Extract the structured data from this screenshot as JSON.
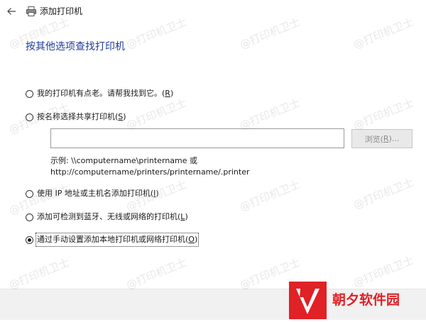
{
  "window": {
    "title": "添加打印机",
    "back_icon": "arrow-left-icon",
    "app_icon": "printer-icon"
  },
  "heading": "按其他选项查找打印机",
  "options": [
    {
      "text": "我的打印机有点老。请帮我找到它。(",
      "accel": "R",
      "close": ")",
      "checked": false
    },
    {
      "text": "按名称选择共享打印机(",
      "accel": "S",
      "close": ")",
      "checked": false
    },
    {
      "text": "使用 IP 地址或主机名添加打印机(",
      "accel": "I",
      "close": ")",
      "checked": false
    },
    {
      "text": "添加可检测到蓝牙、无线或网络的打印机(",
      "accel": "L",
      "close": ")",
      "checked": false
    },
    {
      "text": "通过手动设置添加本地打印机或网络打印机(",
      "accel": "O",
      "close": ")",
      "checked": true
    }
  ],
  "share_input": {
    "value": "",
    "placeholder": ""
  },
  "browse_button": {
    "text": "浏览(",
    "accel": "R",
    "close": ")..."
  },
  "example": {
    "line1": "示例: \\\\computername\\printername 或",
    "line2": "http://computername/printers/printername/.printer"
  },
  "watermark": "@打印机卫士",
  "brand": {
    "name": "朝夕软件园",
    "color": "#e02126"
  },
  "colors": {
    "heading": "#1f3d99",
    "footer": "#f1f1f1"
  }
}
